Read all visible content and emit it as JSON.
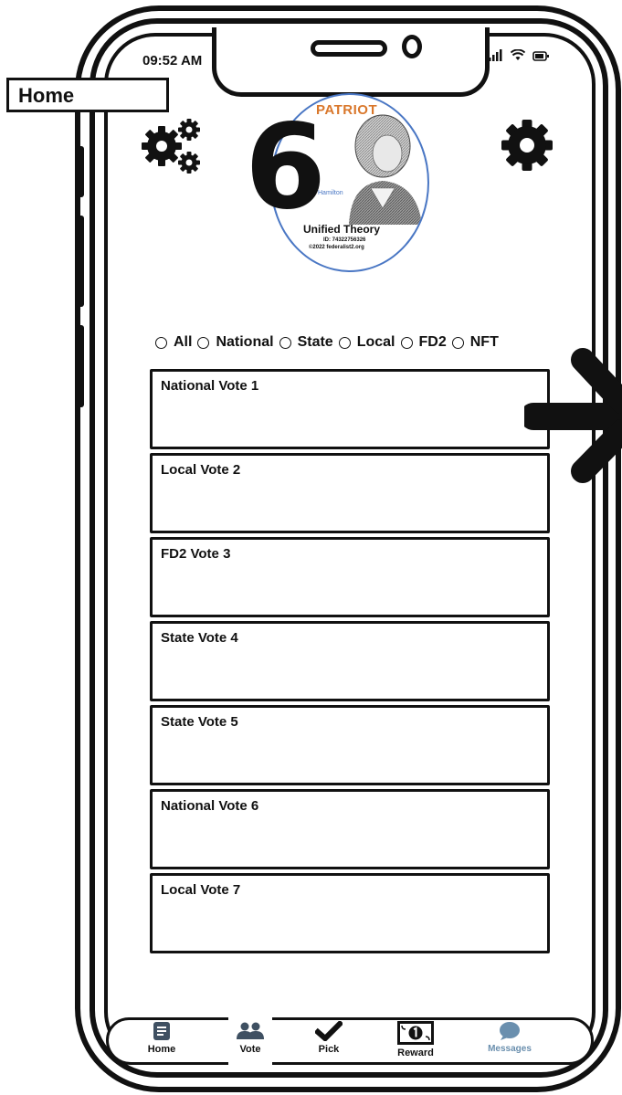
{
  "status_bar": {
    "time": "09:52 AM"
  },
  "page_label": "Home",
  "logo": {
    "big_number": "6",
    "brand": "PATRIOT",
    "portrait_caption": "Hamilton",
    "title": "Unified Theory",
    "id_text": "ID: 74322756326",
    "copyright": "©2022 federalist2.org"
  },
  "filters": [
    {
      "label": "All"
    },
    {
      "label": "National"
    },
    {
      "label": "State"
    },
    {
      "label": "Local"
    },
    {
      "label": "FD2"
    },
    {
      "label": "NFT"
    }
  ],
  "votes": [
    {
      "title": "National Vote 1"
    },
    {
      "title": "Local Vote 2"
    },
    {
      "title": "FD2 Vote 3"
    },
    {
      "title": "State Vote 4"
    },
    {
      "title": "State Vote 5"
    },
    {
      "title": "National Vote 6"
    },
    {
      "title": "Local Vote 7"
    }
  ],
  "bottom_nav": [
    {
      "label": "Home",
      "icon": "home-doc-icon"
    },
    {
      "label": "Vote",
      "icon": "people-icon"
    },
    {
      "label": "Pick",
      "icon": "checkmark-icon"
    },
    {
      "label": "Reward",
      "icon": "dollar-bill-icon"
    },
    {
      "label": "Messages",
      "icon": "chat-bubble-icon"
    }
  ],
  "colors": {
    "frame": "#111111",
    "logo_ring": "#4a77c4",
    "brand": "#d9772b",
    "nav_muted": "#3f5062",
    "messages_icon": "#6a8fae"
  }
}
